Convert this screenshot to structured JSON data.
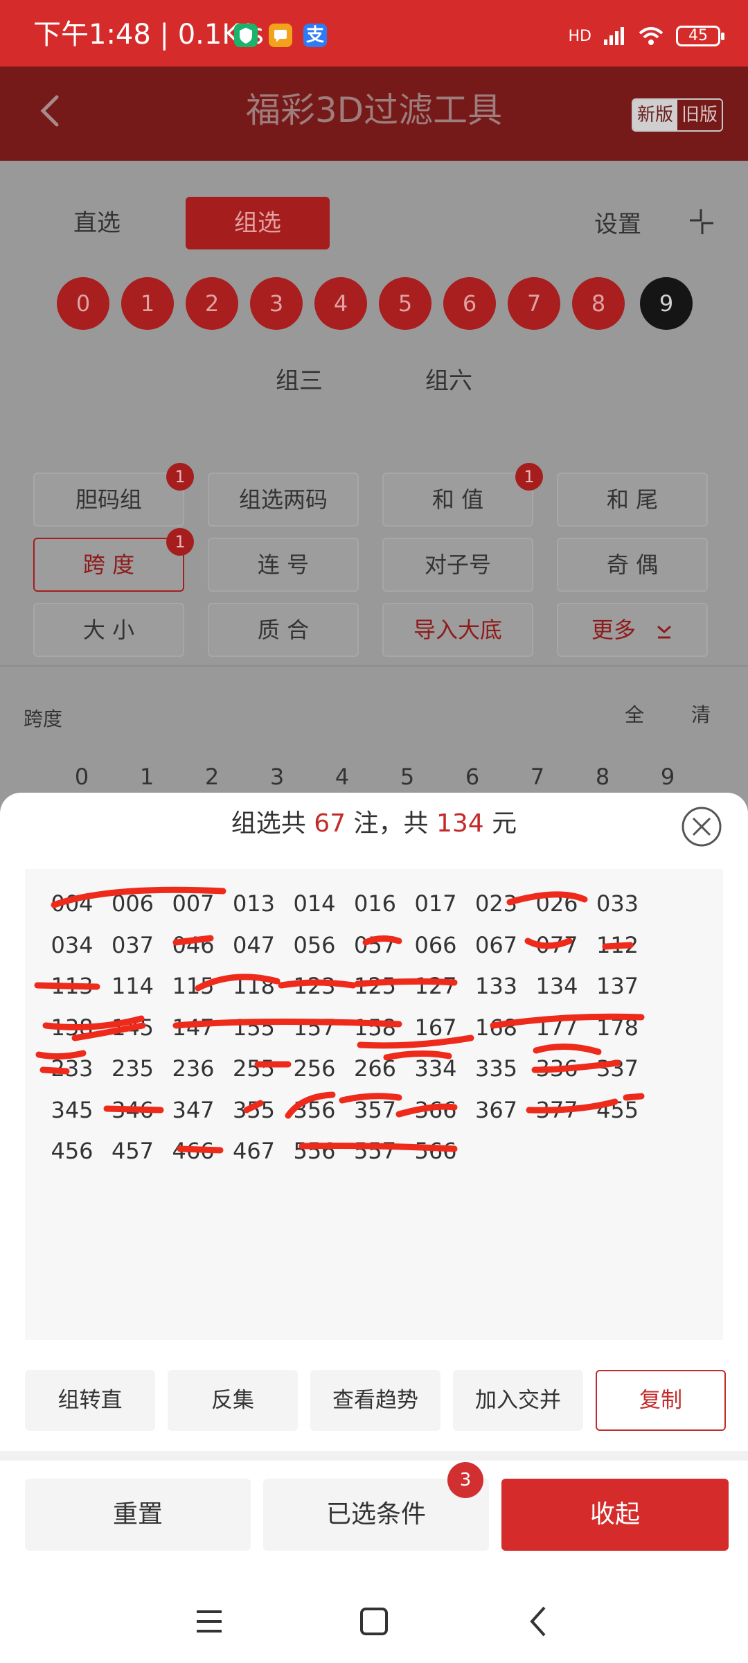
{
  "status_bar": {
    "time": "下午1:48 | 0.1K/s",
    "apps": [
      "shield-app-icon",
      "message-app-icon",
      "alipay-icon"
    ],
    "alipay_glyph": "支",
    "network": "HD",
    "battery": "45"
  },
  "header": {
    "title": "福彩3D过滤工具",
    "version_new": "新版",
    "version_old": "旧版"
  },
  "modes": {
    "direct": "直选",
    "group": "组选",
    "settings": "设置"
  },
  "balls": [
    "0",
    "1",
    "2",
    "3",
    "4",
    "5",
    "6",
    "7",
    "8",
    "9"
  ],
  "group_types": {
    "three": "组三",
    "six": "组六"
  },
  "filters": [
    {
      "label": "胆码组",
      "badge": "1"
    },
    {
      "label": "组选两码",
      "badge": ""
    },
    {
      "label": "和 值",
      "badge": "1"
    },
    {
      "label": "和 尾",
      "badge": ""
    },
    {
      "label": "跨 度",
      "badge": "1"
    },
    {
      "label": "连 号",
      "badge": ""
    },
    {
      "label": "对子号",
      "badge": ""
    },
    {
      "label": "奇 偶",
      "badge": ""
    },
    {
      "label": "大 小",
      "badge": ""
    },
    {
      "label": "质 合",
      "badge": ""
    },
    {
      "label": "导入大底",
      "badge": ""
    },
    {
      "label": "更多",
      "badge": ""
    }
  ],
  "span_section": {
    "title": "跨度",
    "all": "全",
    "clear": "清",
    "digits": [
      "0",
      "1",
      "2",
      "3",
      "4",
      "5",
      "6",
      "7",
      "8",
      "9"
    ]
  },
  "sheet": {
    "summary_prefix": "组选共",
    "count": "67",
    "summary_mid": "注，共",
    "amount": "134",
    "summary_suffix": "元",
    "numbers": [
      "004",
      "006",
      "007",
      "013",
      "014",
      "016",
      "017",
      "023",
      "026",
      "033",
      "034",
      "037",
      "046",
      "047",
      "056",
      "057",
      "066",
      "067",
      "077",
      "112",
      "113",
      "114",
      "115",
      "118",
      "123",
      "125",
      "127",
      "133",
      "134",
      "137",
      "138",
      "145",
      "147",
      "155",
      "157",
      "158",
      "167",
      "168",
      "177",
      "178",
      "233",
      "235",
      "236",
      "255",
      "256",
      "266",
      "334",
      "335",
      "336",
      "337",
      "345",
      "346",
      "347",
      "355",
      "356",
      "357",
      "366",
      "367",
      "377",
      "455",
      "456",
      "457",
      "466",
      "467",
      "556",
      "557",
      "566"
    ],
    "actions": [
      "组转直",
      "反集",
      "查看趋势",
      "加入交并",
      "复制"
    ]
  },
  "footer": {
    "reset": "重置",
    "conditions": "已选条件",
    "conditions_badge": "3",
    "collapse": "收起"
  },
  "colors": {
    "accent": "#d52b2b",
    "text": "#333333",
    "scribble": "#ee2a1a"
  }
}
